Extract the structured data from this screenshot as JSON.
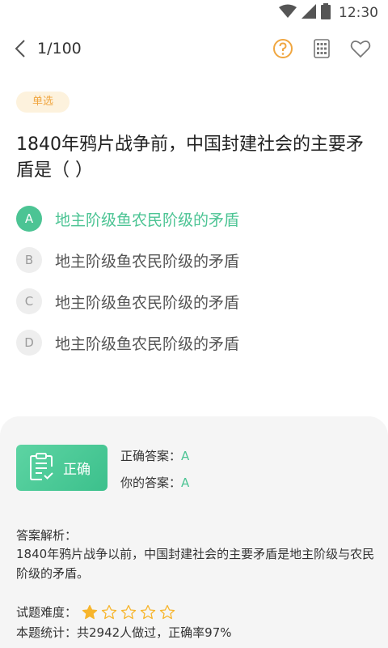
{
  "status_bar": {
    "time": "12:30"
  },
  "header": {
    "progress": "1/100"
  },
  "question": {
    "type_tag": "单选",
    "text": "1840年鸦片战争前，中国封建社会的主要矛盾是（    ）",
    "options": [
      {
        "letter": "A",
        "text": "地主阶级鱼农民阶级的矛盾"
      },
      {
        "letter": "B",
        "text": "地主阶级鱼农民阶级的矛盾"
      },
      {
        "letter": "C",
        "text": "地主阶级鱼农民阶级的矛盾"
      },
      {
        "letter": "D",
        "text": "地主阶级鱼农民阶级的矛盾"
      }
    ]
  },
  "result": {
    "badge_label": "正确",
    "correct_answer_label": "正确答案：",
    "correct_answer": "A",
    "your_answer_label": "你的答案：",
    "your_answer": "A",
    "analysis_title": "答案解析：",
    "analysis_text": "1840年鸦片战争以前，中国封建社会的主要矛盾是地主阶级与农民阶级的矛盾。",
    "difficulty_label": "试题难度：",
    "difficulty_rating": 1,
    "difficulty_max": 5,
    "stats_text": "本题统计：共2942人做过，正确率97%"
  },
  "colors": {
    "accent_green": "#4cc494",
    "accent_orange": "#f0a640",
    "star_gold": "#f7b52c"
  }
}
